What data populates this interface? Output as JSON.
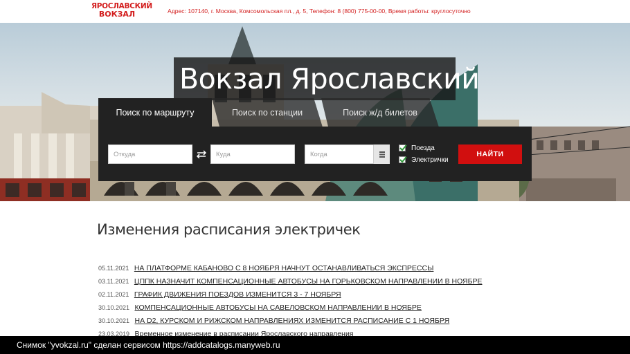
{
  "header": {
    "logo_line1": "ЯРОСЛАВСКИЙ",
    "logo_line2": "ВОКЗАЛ",
    "address": "Адрес: 107140, г. Москва, Комсомольская пл., д. 5, Телефон: 8 (800) 775-00-00, Время работы: круглосуточно"
  },
  "hero": {
    "title": "Вокзал Ярославский"
  },
  "tabs": [
    {
      "label": "Поиск по маршруту",
      "active": true
    },
    {
      "label": "Поиск по станции",
      "active": false
    },
    {
      "label": "Поиск ж/д билетов",
      "active": false
    }
  ],
  "search": {
    "from_placeholder": "Откуда",
    "to_placeholder": "Куда",
    "when_placeholder": "Когда",
    "trains_label": "Поезда",
    "trains_checked": true,
    "elektrichki_label": "Электрички",
    "elektrichki_checked": true,
    "find_label": "НАЙТИ"
  },
  "news": {
    "title": "Изменения расписания электричек",
    "items": [
      {
        "date": "05.11.2021",
        "text": "НА ПЛАТФОРМЕ КАБАНОВО С 8 НОЯБРЯ НАЧНУТ ОСТАНАВЛИВАТЬСЯ ЭКСПРЕССЫ"
      },
      {
        "date": "03.11.2021",
        "text": "ЦППК НАЗНАЧИТ КОМПЕНСАЦИОННЫЕ АВТОБУСЫ НА ГОРЬКОВСКОМ НАПРАВЛЕНИИ В НОЯБРЕ"
      },
      {
        "date": "02.11.2021",
        "text": "ГРАФИК ДВИЖЕНИЯ ПОЕЗДОВ ИЗМЕНИТСЯ 3 - 7 НОЯБРЯ"
      },
      {
        "date": "30.10.2021",
        "text": "КОМПЕНСАЦИОННЫЕ АВТОБУСЫ НА САВЕЛОВСКОМ НАПРАВЛЕНИИ В НОЯБРЕ"
      },
      {
        "date": "30.10.2021",
        "text": "НА D2, КУРСКОМ И РИЖСКОМ НАПРАВЛЕНИЯХ ИЗМЕНИТСЯ РАСПИСАНИЕ С 1 НОЯБРЯ"
      },
      {
        "date": "23.03.2019",
        "text": "Временное изменение в расписании Ярославского направления"
      }
    ]
  },
  "caption": "Снимок \"yvokzal.ru\" сделан сервисом https://addcatalogs.manyweb.ru",
  "colors": {
    "brand_red": "#d31f1f",
    "button_red": "#d10f0f",
    "panel_dark": "#222222"
  }
}
